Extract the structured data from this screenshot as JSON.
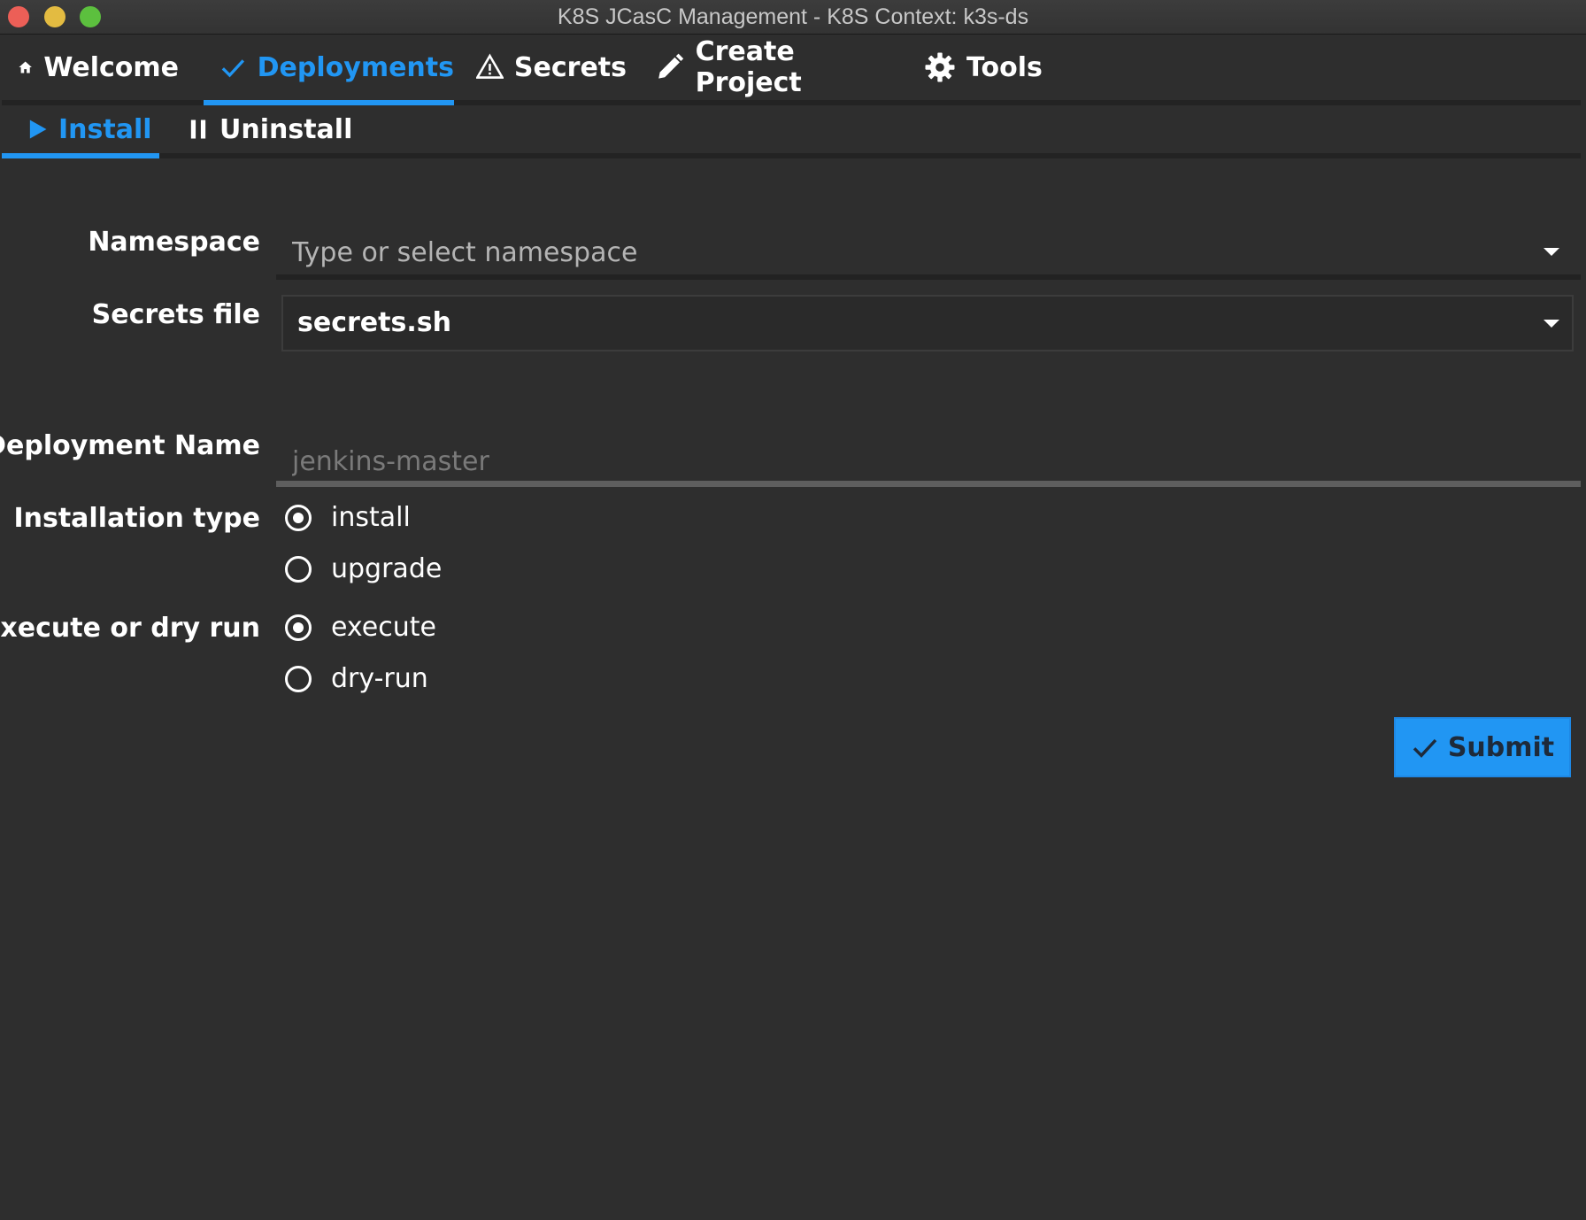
{
  "window": {
    "title": "K8S JCasC Management - K8S Context: k3s-ds"
  },
  "tabs": [
    {
      "label": "Welcome",
      "icon": "home-icon"
    },
    {
      "label": "Deployments",
      "icon": "check-icon",
      "active": true
    },
    {
      "label": "Secrets",
      "icon": "warning-icon"
    },
    {
      "label": "Create Project",
      "icon": "pencil-icon"
    },
    {
      "label": "Tools",
      "icon": "gear-icon"
    }
  ],
  "subtabs": [
    {
      "label": "Install",
      "icon": "play-icon",
      "active": true
    },
    {
      "label": "Uninstall",
      "icon": "pause-icon"
    }
  ],
  "form": {
    "namespace": {
      "label": "Namespace",
      "value": "",
      "placeholder": "Type or select namespace"
    },
    "secrets_file": {
      "label": "Secrets file",
      "value": "secrets.sh"
    },
    "deployment_name": {
      "label": "Deployment Name",
      "value": "",
      "placeholder": "jenkins-master"
    },
    "installation_type": {
      "label": "Installation type",
      "options": [
        "install",
        "upgrade"
      ],
      "selected": "install"
    },
    "execute_mode": {
      "label": "Execute or dry run",
      "options": [
        "execute",
        "dry-run"
      ],
      "selected": "execute"
    },
    "submit_label": "Submit"
  },
  "colors": {
    "accent": "#2196f3",
    "background": "#2e2e2e",
    "text": "#ffffff"
  }
}
